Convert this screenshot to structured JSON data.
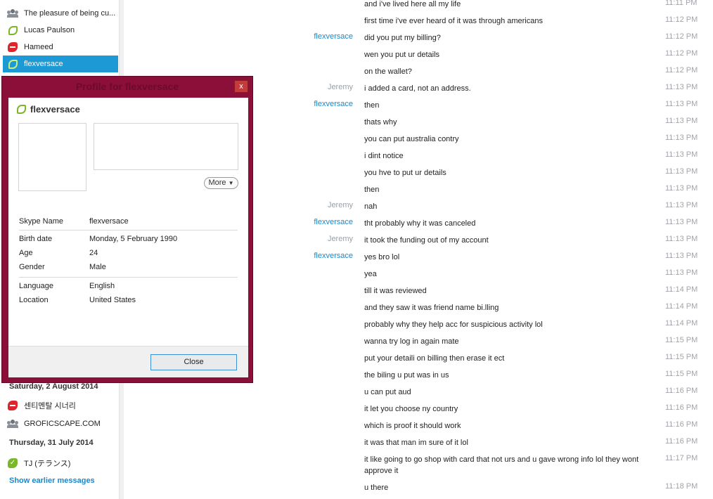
{
  "sidebar": {
    "items": [
      {
        "label": "The pleasure of being cu...",
        "icon": "group-icon",
        "status": "group"
      },
      {
        "label": "Lucas Paulson",
        "icon": "status-away-icon",
        "status": "away"
      },
      {
        "label": "Hameed",
        "icon": "status-dnd-icon",
        "status": "dnd"
      },
      {
        "label": "flexversace",
        "icon": "status-away-icon",
        "status": "away",
        "selected": true
      }
    ],
    "sections": [
      {
        "date": "Saturday, 2 August 2014",
        "items": [
          {
            "label": "센티멘탈 시너리",
            "icon": "status-dnd-icon",
            "status": "dnd"
          },
          {
            "label": "GROFICSCAPE.COM",
            "icon": "group-icon",
            "status": "group"
          }
        ]
      },
      {
        "date": "Thursday, 31 July 2014",
        "items": [
          {
            "label": "TJ (テランス)",
            "icon": "status-online-icon",
            "status": "online"
          }
        ]
      }
    ],
    "show_earlier": "Show earlier messages"
  },
  "dialog": {
    "title": "Profile for flexversace",
    "close_x": "x",
    "username": "flexversace",
    "more_label": "More",
    "fields_group1": [
      {
        "key": "Skype Name",
        "value": "flexversace"
      }
    ],
    "fields_group2": [
      {
        "key": "Birth date",
        "value": "Monday, 5 February 1990"
      },
      {
        "key": "Age",
        "value": "24"
      },
      {
        "key": "Gender",
        "value": "Male"
      }
    ],
    "fields_group3": [
      {
        "key": "Language",
        "value": "English"
      },
      {
        "key": "Location",
        "value": "United States"
      }
    ],
    "close_label": "Close"
  },
  "chat": {
    "messages": [
      {
        "sender": "",
        "text": "and i've lived here all my life",
        "time": "11:11 PM"
      },
      {
        "sender": "",
        "text": "first time i've ever heard of it was through americans",
        "time": "11:12 PM"
      },
      {
        "sender": "flexversace",
        "text": "did you put my billing?",
        "time": "11:12 PM"
      },
      {
        "sender": "",
        "text": "wen you put ur details",
        "time": "11:12 PM"
      },
      {
        "sender": "",
        "text": "on the wallet?",
        "time": "11:12 PM"
      },
      {
        "sender": "Jeremy",
        "text": "i added a card, not an address.",
        "time": "11:13 PM"
      },
      {
        "sender": "flexversace",
        "text": "then",
        "time": "11:13 PM"
      },
      {
        "sender": "",
        "text": "thats why",
        "time": "11:13 PM"
      },
      {
        "sender": "",
        "text": "you can put australia contry",
        "time": "11:13 PM"
      },
      {
        "sender": "",
        "text": "i dint notice",
        "time": "11:13 PM"
      },
      {
        "sender": "",
        "text": "you hve to put ur details",
        "time": "11:13 PM"
      },
      {
        "sender": "",
        "text": "then",
        "time": "11:13 PM"
      },
      {
        "sender": "Jeremy",
        "text": "nah",
        "time": "11:13 PM"
      },
      {
        "sender": "flexversace",
        "text": "tht probably why it was canceled",
        "time": "11:13 PM"
      },
      {
        "sender": "Jeremy",
        "text": "it took the funding out of my account",
        "time": "11:13 PM"
      },
      {
        "sender": "flexversace",
        "text": "yes bro lol",
        "time": "11:13 PM"
      },
      {
        "sender": "",
        "text": "yea",
        "time": "11:13 PM"
      },
      {
        "sender": "",
        "text": "till it was reviewed",
        "time": "11:14 PM"
      },
      {
        "sender": "",
        "text": "and they saw it was friend name bi.lling",
        "time": "11:14 PM"
      },
      {
        "sender": "",
        "text": "probably why they help acc for suspicious activity lol",
        "time": "11:14 PM"
      },
      {
        "sender": "",
        "text": "wanna try log in again mate",
        "time": "11:15 PM"
      },
      {
        "sender": "",
        "text": "put your detaili on billing then erase it ect",
        "time": "11:15 PM"
      },
      {
        "sender": "",
        "text": "the biling u put was in us",
        "time": "11:15 PM"
      },
      {
        "sender": "",
        "text": "u can put aud",
        "time": "11:16 PM"
      },
      {
        "sender": "",
        "text": "it let you choose ny country",
        "time": "11:16 PM"
      },
      {
        "sender": "",
        "text": "which is proof it should work",
        "time": "11:16 PM"
      },
      {
        "sender": "",
        "text": "it was that man im sure of it lol",
        "time": "11:16 PM"
      },
      {
        "sender": "",
        "text": "it like going to go shop with card that not urs and u gave wrong info lol they wont approve it",
        "time": "11:17 PM"
      },
      {
        "sender": "",
        "text": "u there",
        "time": "11:18 PM"
      }
    ]
  },
  "colors": {
    "accent": "#1d9ad6",
    "dialog_frame": "#8c0f3a",
    "link": "#1b87c9"
  }
}
